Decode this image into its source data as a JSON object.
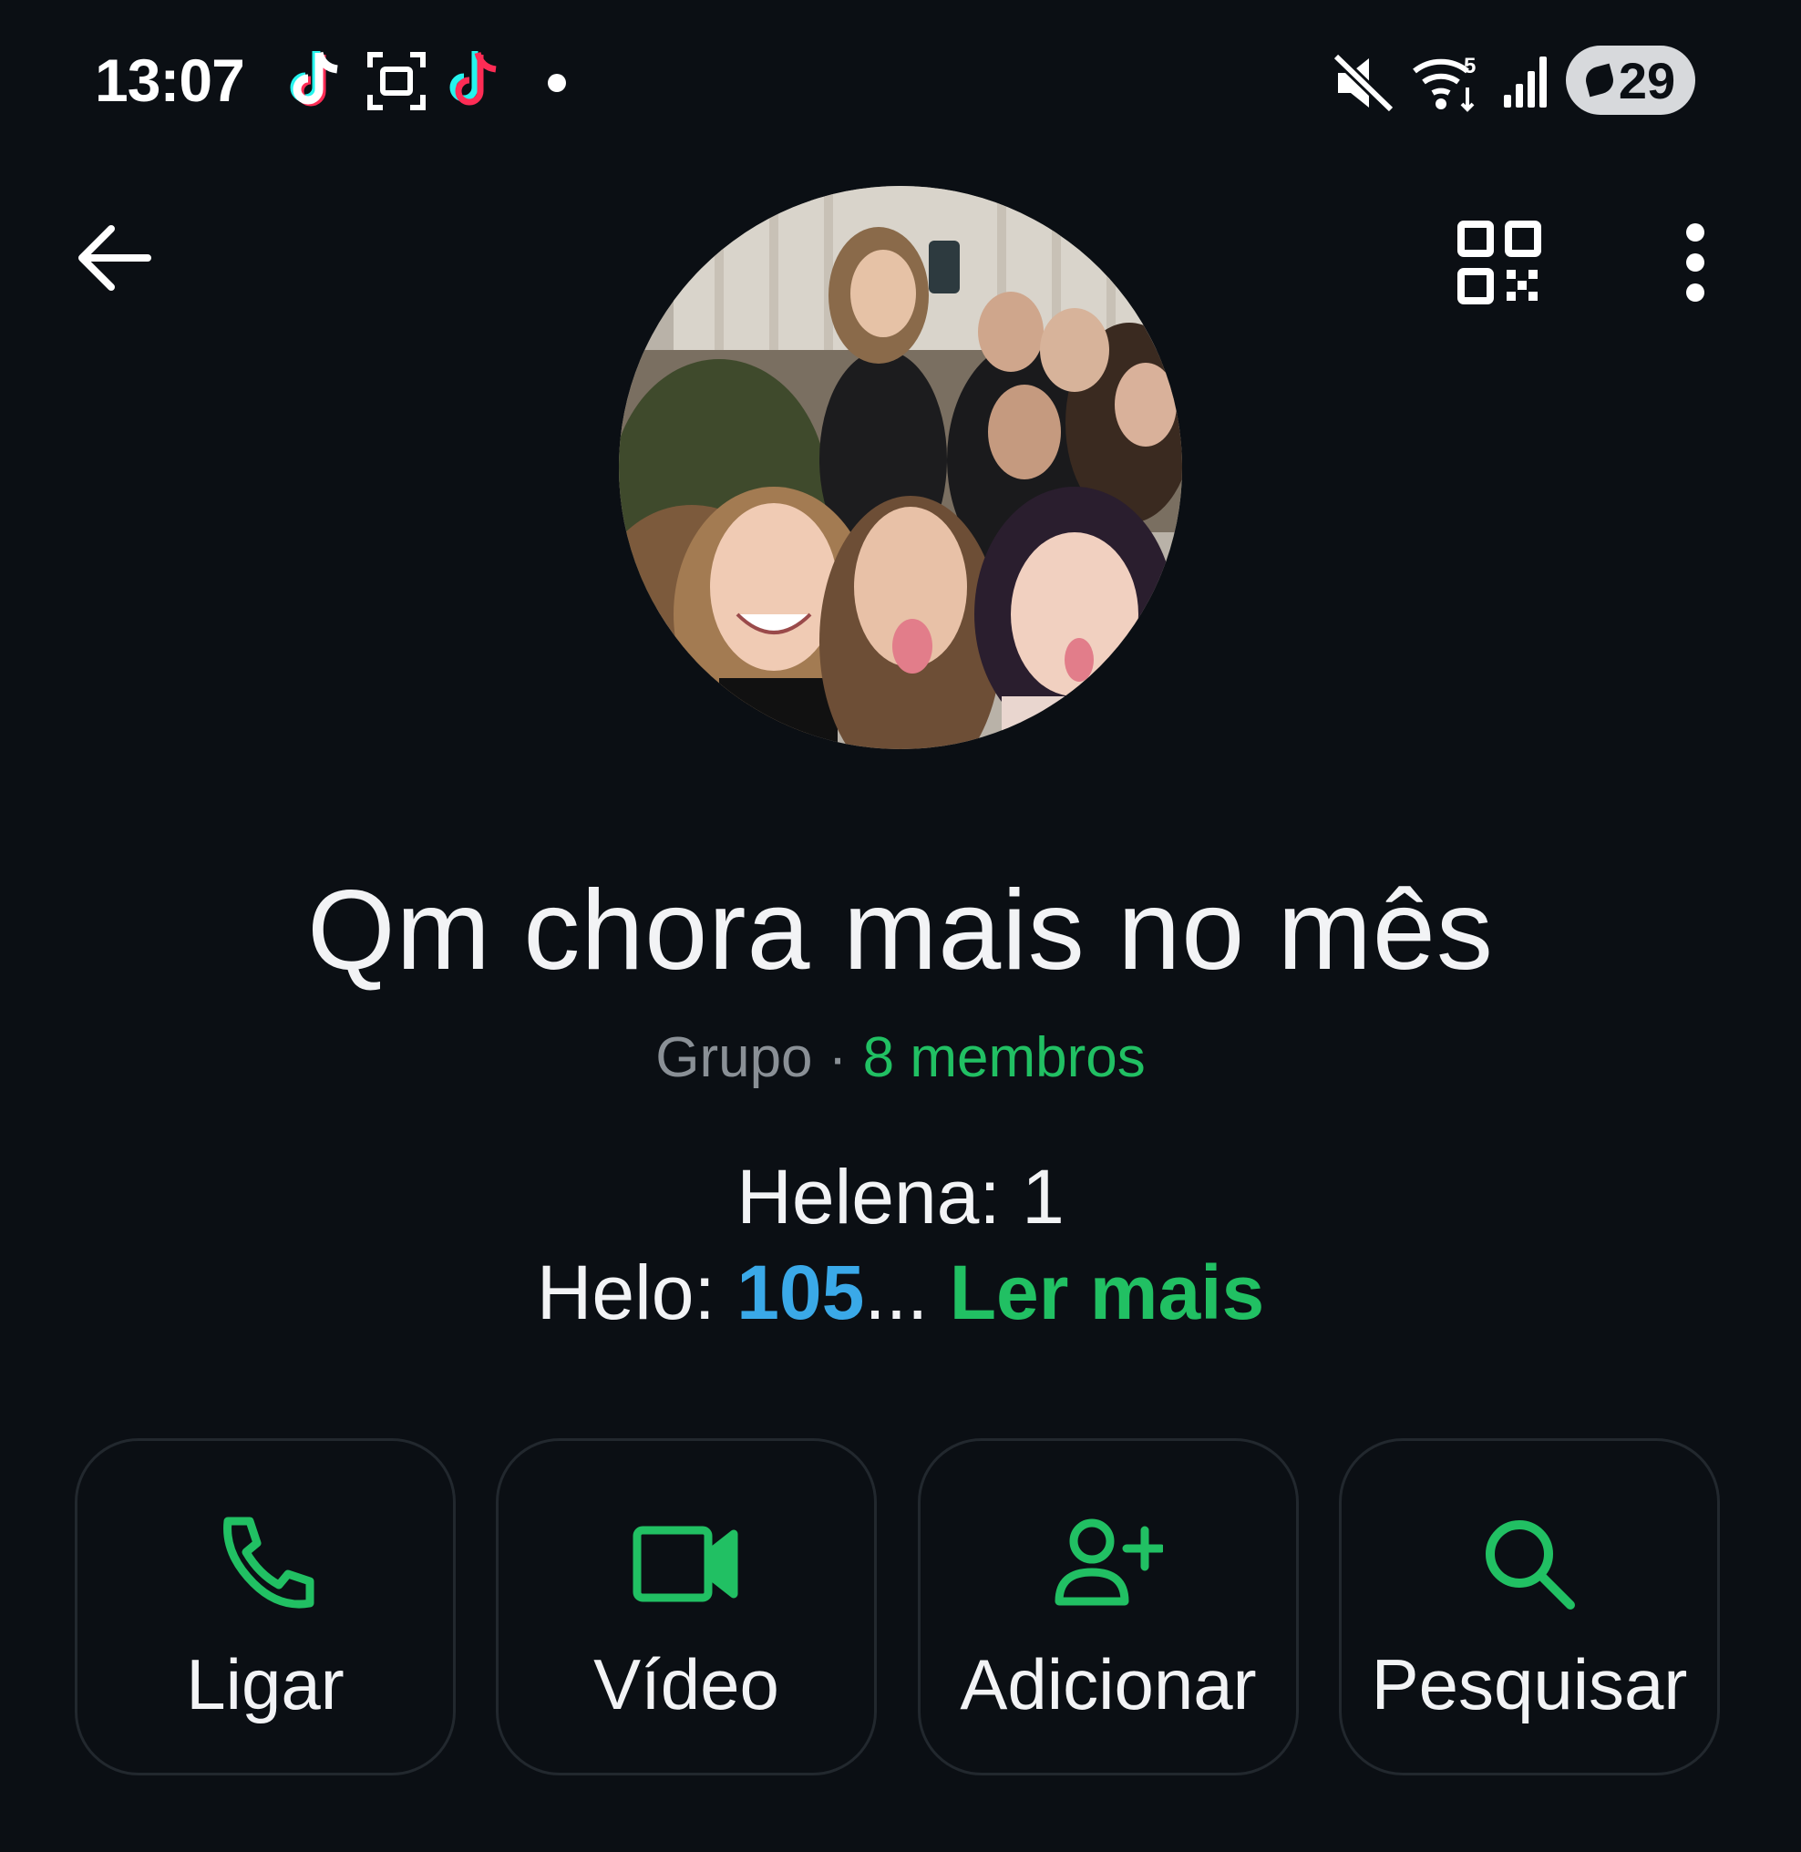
{
  "status_bar": {
    "time": "13:07",
    "icons": [
      "tiktok-icon",
      "screenshot-icon",
      "tiktok-icon",
      "dot-icon",
      "mute-icon",
      "wifi-icon",
      "signal-icon"
    ],
    "battery": "29"
  },
  "app_bar": {
    "back_icon": "arrow-left-icon",
    "qr_icon": "qr-code-icon",
    "menu_icon": "more-vert-icon"
  },
  "group": {
    "title": "Qm chora mais no mês",
    "type": "Grupo",
    "separator": "·",
    "members": "8 membros",
    "description_line1": "Helena: 1",
    "description_line2_prefix": "Helo: ",
    "description_line2_number": "105",
    "description_line2_ellipsis": "...",
    "read_more": "Ler mais"
  },
  "actions": [
    {
      "label": "Ligar",
      "icon": "phone-icon"
    },
    {
      "label": "Vídeo",
      "icon": "video-icon"
    },
    {
      "label": "Adicionar",
      "icon": "add-person-icon"
    },
    {
      "label": "Pesquisar",
      "icon": "search-icon"
    }
  ],
  "colors": {
    "background": "#0b0f14",
    "accent_green": "#21c063",
    "link_blue": "#3aa9e8",
    "muted_text": "#8a9096"
  }
}
